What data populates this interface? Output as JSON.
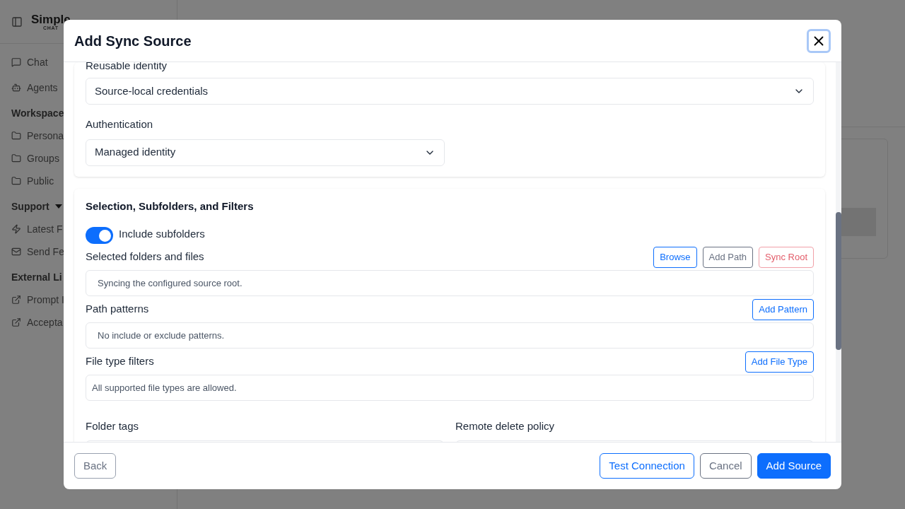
{
  "sidebar": {
    "logo": {
      "title": "Simple",
      "subtitle": "CHAT"
    },
    "items": [
      {
        "label": "Chat"
      },
      {
        "label": "Agents"
      }
    ],
    "sections": [
      {
        "title": "Workspace",
        "caret": false,
        "items": [
          {
            "label": "Persona"
          },
          {
            "label": "Groups"
          },
          {
            "label": "Public"
          }
        ]
      },
      {
        "title": "Support",
        "caret": true,
        "items": [
          {
            "label": "Latest F"
          },
          {
            "label": "Send Fe"
          }
        ]
      },
      {
        "title": "External Li",
        "caret": false,
        "items": [
          {
            "label": "Prompt I"
          },
          {
            "label": "Accepta"
          }
        ]
      }
    ]
  },
  "dialog": {
    "title": "Add Sync Source",
    "identity": {
      "label": "Reusable identity",
      "value": "Source-local credentials"
    },
    "authentication": {
      "label": "Authentication",
      "value": "Managed identity"
    },
    "selection": {
      "title": "Selection, Subfolders, and Filters",
      "include_subfolders": {
        "label": "Include subfolders",
        "on": true
      },
      "groups": [
        {
          "label": "Selected folders and files",
          "empty_text": "Syncing the configured source root.",
          "buttons": [
            {
              "label": "Browse",
              "kind": "primary"
            },
            {
              "label": "Add Path",
              "kind": "secondary"
            },
            {
              "label": "Sync Root",
              "kind": "danger"
            }
          ]
        },
        {
          "label": "Path patterns",
          "empty_text": "No include or exclude patterns.",
          "buttons": [
            {
              "label": "Add Pattern",
              "kind": "primary"
            }
          ]
        },
        {
          "label": "File type filters",
          "empty_text": "All supported file types are allowed.",
          "buttons": [
            {
              "label": "Add File Type",
              "kind": "primary"
            }
          ]
        }
      ],
      "folder_tags": {
        "label": "Folder tags"
      },
      "remote_delete_policy": {
        "label": "Remote delete policy"
      }
    },
    "footer": {
      "back": "Back",
      "buttons": [
        {
          "label": "Test Connection",
          "kind": "outline-primary"
        },
        {
          "label": "Cancel",
          "kind": "secondary"
        },
        {
          "label": "Add Source",
          "kind": "solid"
        }
      ]
    }
  }
}
